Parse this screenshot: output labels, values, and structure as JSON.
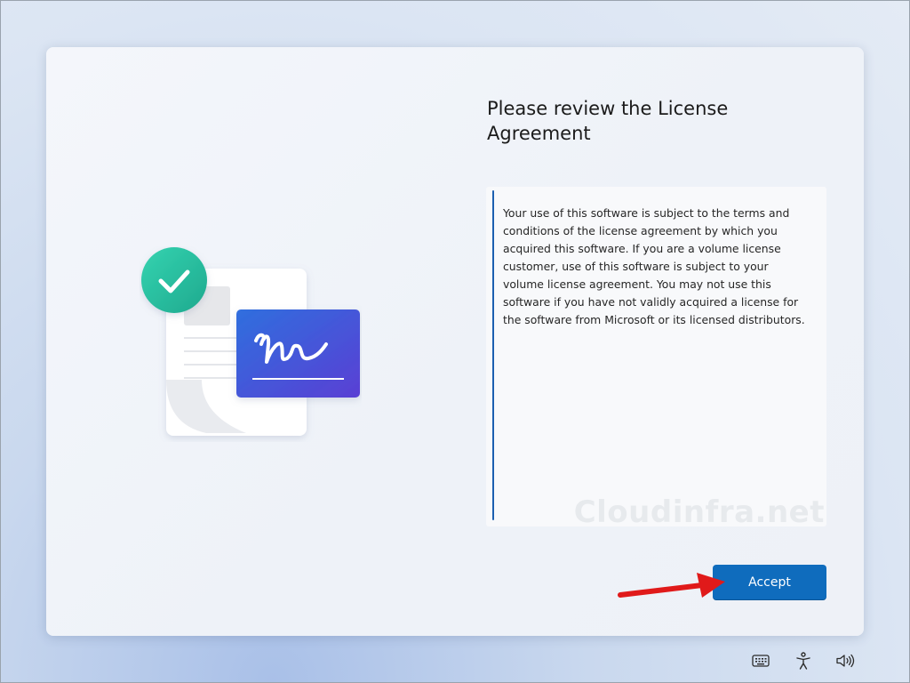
{
  "dialog": {
    "title": "Please review the License Agreement",
    "license_text": "Your use of this software is subject to the terms and conditions of the license agreement by which you acquired this software. If you are a volume license customer, use of this software is subject to your volume license agreement. You may not use this software if you have not validly acquired a license for the software from Microsoft or its licensed distributors.",
    "watermark": "Cloudinfra.net",
    "accept_label": "Accept"
  },
  "illustration": {
    "icons": [
      "document-icon",
      "checkmark-icon",
      "signature-icon"
    ],
    "colors": {
      "check": "#2bc3a3",
      "signature_start": "#2f6fde",
      "signature_end": "#5a3fd4"
    }
  },
  "annotation": {
    "icon": "red-arrow-icon",
    "color": "#e01a1a"
  },
  "taskbar": {
    "icons": [
      "keyboard-icon",
      "accessibility-icon",
      "volume-icon"
    ]
  },
  "colors": {
    "accent": "#0f6cbd",
    "scrollbar": "#1c5fb0"
  }
}
